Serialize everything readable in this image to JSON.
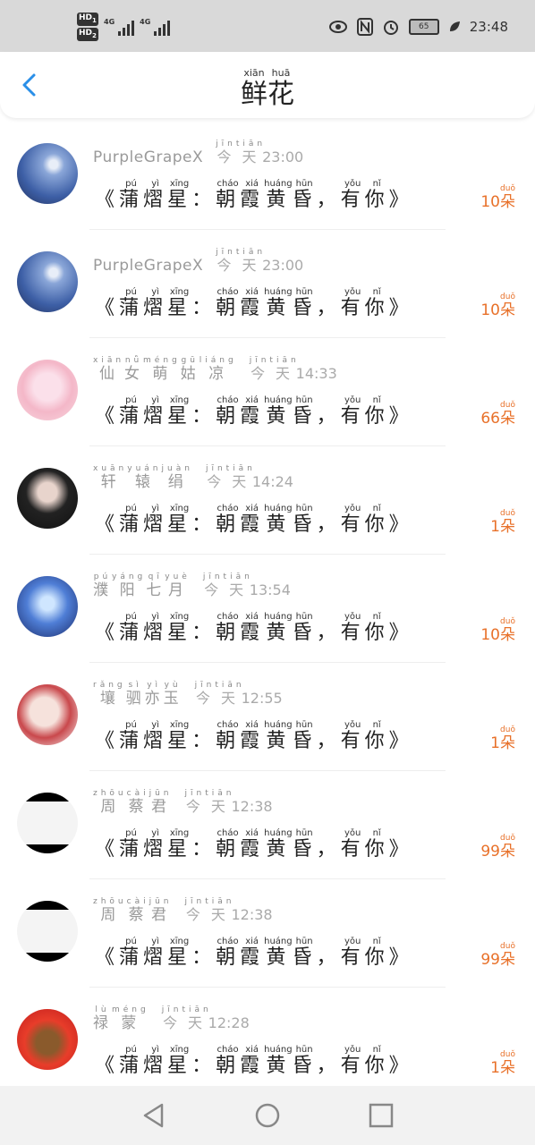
{
  "status_bar": {
    "hd1": "HD",
    "hd1_sub": "1",
    "hd2": "HD",
    "hd2_sub": "2",
    "net1": "4G",
    "net2": "4G",
    "battery": "65",
    "time": "23:48"
  },
  "header": {
    "title_chars": [
      [
        "鲜",
        "xiān"
      ],
      [
        "花",
        "huā"
      ]
    ]
  },
  "message_chars": [
    [
      "《",
      ""
    ],
    [
      "蒲",
      "pú"
    ],
    [
      "熠",
      "yì"
    ],
    [
      "星",
      "xīng"
    ],
    [
      "：",
      ""
    ],
    [
      "朝",
      "cháo"
    ],
    [
      "霞",
      "xiá"
    ],
    [
      "黄",
      "huáng"
    ],
    [
      "昏",
      "hūn"
    ],
    [
      "，",
      ""
    ],
    [
      "有",
      "yǒu"
    ],
    [
      "你",
      "nǐ"
    ],
    [
      "》",
      ""
    ]
  ],
  "today": [
    [
      "今",
      "jīn"
    ],
    [
      "天",
      "tiān"
    ]
  ],
  "unit": [
    "朵",
    "duǒ"
  ],
  "rows": [
    {
      "name": "PurpleGrapeX",
      "name_ruby": [],
      "time": "23:00",
      "amount": "10"
    },
    {
      "name": "PurpleGrapeX",
      "name_ruby": [],
      "time": "23:00",
      "amount": "10"
    },
    {
      "name": "",
      "name_ruby": [
        [
          "仙",
          "xiān"
        ],
        [
          "女",
          "nǚ"
        ],
        [
          "萌",
          "méng"
        ],
        [
          "姑",
          "gū"
        ],
        [
          "凉",
          "liáng"
        ]
      ],
      "time": "14:33",
      "amount": "66"
    },
    {
      "name": "",
      "name_ruby": [
        [
          "轩",
          "xuān"
        ],
        [
          "辕",
          "yuán"
        ],
        [
          "绢",
          "juàn"
        ]
      ],
      "time": "14:24",
      "amount": "1"
    },
    {
      "name": "",
      "name_ruby": [
        [
          "濮",
          "pú"
        ],
        [
          "阳",
          "yáng"
        ],
        [
          "七",
          "qī"
        ],
        [
          "月",
          "yuè"
        ]
      ],
      "time": "13:54",
      "amount": "10"
    },
    {
      "name": "",
      "name_ruby": [
        [
          "壤",
          "rǎng"
        ],
        [
          "驷",
          "sì"
        ],
        [
          "亦",
          "yì"
        ],
        [
          "玉",
          "yù"
        ]
      ],
      "time": "12:55",
      "amount": "1"
    },
    {
      "name": "",
      "name_ruby": [
        [
          "周",
          "zhōu"
        ],
        [
          "蔡",
          "cài"
        ],
        [
          "君",
          "jūn"
        ]
      ],
      "time": "12:38",
      "amount": "99"
    },
    {
      "name": "",
      "name_ruby": [
        [
          "周",
          "zhōu"
        ],
        [
          "蔡",
          "cài"
        ],
        [
          "君",
          "jūn"
        ]
      ],
      "time": "12:38",
      "amount": "99"
    },
    {
      "name": "",
      "name_ruby": [
        [
          "禄",
          "lù"
        ],
        [
          "蒙",
          "méng"
        ]
      ],
      "time": "12:28",
      "amount": "1"
    }
  ],
  "colors": {
    "accent": "#e8712a",
    "back": "#2a8fe8"
  }
}
